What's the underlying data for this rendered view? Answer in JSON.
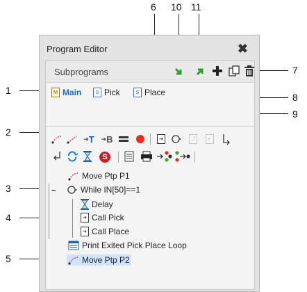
{
  "window": {
    "title": "Program Editor",
    "close_glyph": "✖"
  },
  "subprograms": {
    "heading": "Subprograms",
    "items": [
      {
        "label": "Main",
        "icon": "main-program-icon",
        "active": true
      },
      {
        "label": "Pick",
        "icon": "subprogram-icon"
      },
      {
        "label": "Place",
        "icon": "subprogram-icon"
      }
    ],
    "toolbar": {
      "import_icon": "import-arrow-icon",
      "export_icon": "export-arrow-icon",
      "add_icon": "plus-icon",
      "copy_icon": "copy-icon",
      "delete_icon": "trash-icon"
    }
  },
  "command_toolbar": {
    "row1": [
      "move-ptp-icon",
      "move-lin-icon",
      "set-output-T-icon",
      "set-output-B-icon",
      "equals-icon",
      "red-dot-icon",
      "call-icon",
      "loop-icon",
      "disabled-1-icon",
      "disabled-2-icon",
      "branch-icon"
    ],
    "row2": [
      "return-icon",
      "refresh-icon",
      "hourglass-icon",
      "stop-icon",
      "print-doc-icon",
      "printer-icon",
      "signal-red-icon",
      "signal-green-icon"
    ],
    "labels": {
      "t": "T",
      "b": "B",
      "s": "S"
    }
  },
  "program": {
    "lines": [
      {
        "text": "Move Ptp P1",
        "indent": 0
      },
      {
        "text": "While IN[50]==1",
        "indent": 0,
        "collapse": "–"
      },
      {
        "text": "Delay",
        "indent": 1
      },
      {
        "text": "Call Pick",
        "indent": 1
      },
      {
        "text": "Call Place",
        "indent": 1
      },
      {
        "text": "Print Exited Pick Place Loop",
        "indent": 0
      },
      {
        "text": "Move Ptp P2",
        "indent": 0,
        "selected": true
      }
    ]
  },
  "callouts": [
    "1",
    "2",
    "3",
    "4",
    "5",
    "6",
    "7",
    "8",
    "9",
    "10",
    "11"
  ]
}
